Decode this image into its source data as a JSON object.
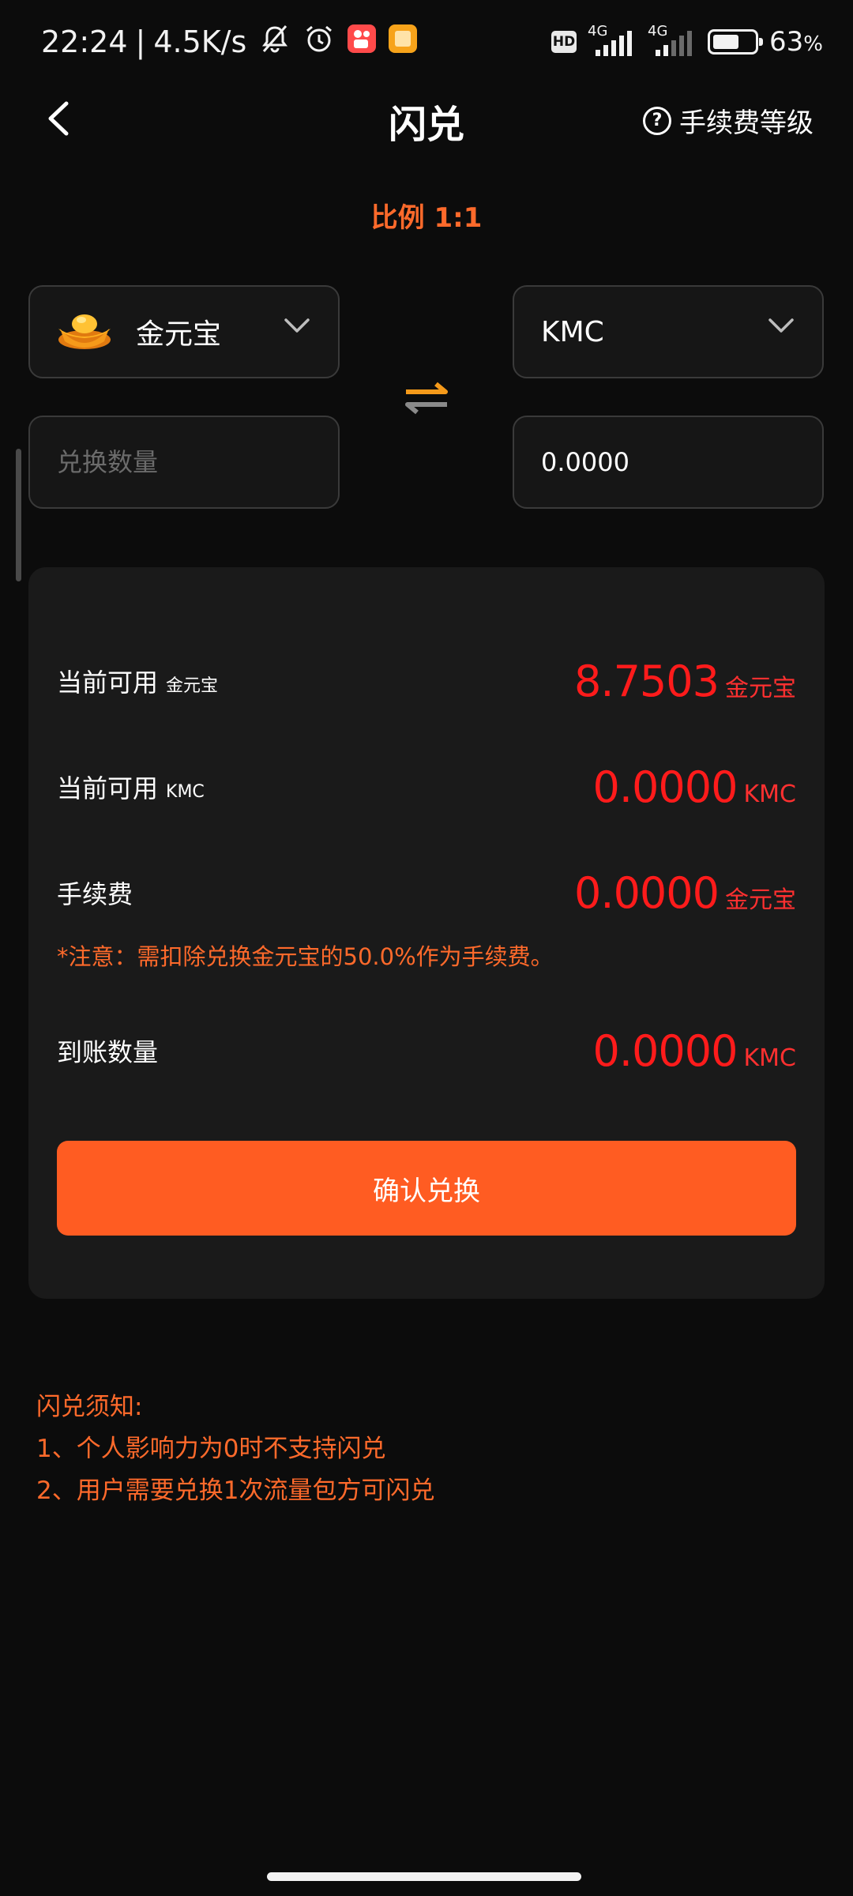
{
  "status_bar": {
    "time": "22:24",
    "separator": "|",
    "net_speed": "4.5K/s",
    "icons": [
      "mute-icon",
      "alarm-icon",
      "kuaishou-app-icon",
      "notes-app-icon",
      "hd-icon",
      "signal-4g-icon",
      "signal-4g-icon",
      "battery-icon"
    ],
    "hd_label": "HD",
    "sim1_label": "4G",
    "sim2_label": "4G",
    "battery_percent": "63",
    "battery_unit": "%",
    "battery_level": 0.63
  },
  "header": {
    "title": "闪兑",
    "fee_level_label": "手续费等级"
  },
  "ratio_label": "比例 1:1",
  "from": {
    "token": "金元宝",
    "icon": "gold-ingot-icon",
    "amount_placeholder": "兑换数量"
  },
  "to": {
    "token": "KMC",
    "amount_value": "0.0000"
  },
  "details": {
    "available_from_label": "当前可用",
    "available_from_unit_label": "金元宝",
    "available_from_value": "8.7503",
    "available_from_unit": "金元宝",
    "available_to_label": "当前可用",
    "available_to_unit_label": "KMC",
    "available_to_value": "0.0000",
    "available_to_unit": "KMC",
    "fee_label": "手续费",
    "fee_value": "0.0000",
    "fee_unit": "金元宝",
    "note": "*注意：需扣除兑换金元宝的50.0%作为手续费。",
    "received_label": "到账数量",
    "received_value": "0.0000",
    "received_unit": "KMC"
  },
  "confirm_button": "确认兑换",
  "notice": {
    "title": "闪兑须知:",
    "items": [
      "1、个人影响力为0时不支持闪兑",
      "2、用户需要兑换1次流量包方可闪兑"
    ]
  },
  "colors": {
    "background": "#0c0c0c",
    "card": "#1a1a1a",
    "accent_orange": "#ff6a2b",
    "button": "#ff5c22",
    "value_red": "#ff1b1b"
  }
}
